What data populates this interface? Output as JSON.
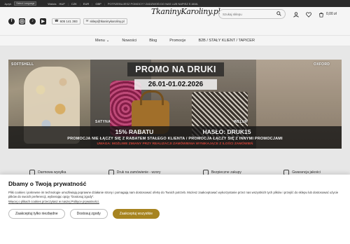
{
  "topbar": {
    "lang_label": "Język",
    "lang_value": "Select Language",
    "currency_label": "Waluta",
    "currencies": [
      "HUF",
      "CZK",
      "EUR",
      "GBP"
    ],
    "notice": "POTRZEBUJESZ POMOCY? ZADZWOŃ DO NAS LUB NAPISZ E-MAIL"
  },
  "header": {
    "phone": "605 141 393",
    "email": "sklep@tkaninykaroliny.pl",
    "logo_text": "TkaninyKaroliny.pl",
    "search_placeholder": "Szukaj sklepu",
    "cart_total": "0,00 zł",
    "icons": [
      "facebook-icon",
      "instagram-icon",
      "tiktok-icon",
      "youtube-icon",
      "phone-icon",
      "mail-icon",
      "search-icon",
      "user-icon",
      "heart-icon",
      "cart-icon"
    ]
  },
  "nav": {
    "items": [
      "Menu",
      "Nowości",
      "Blog",
      "Promocje",
      "B2B / STAŁY KLIENT / TAPICER"
    ]
  },
  "banner": {
    "tags": [
      "SOFTSHELL",
      "SATYNA",
      "WELUR",
      "OXFORD"
    ],
    "title": "PROMO NA DRUKI",
    "date": "26.01-01.02.2026",
    "discount": "15% RABATU",
    "code": "HASŁO: DRUK15",
    "line2": "PROMOCJA NIE ŁĄCZY SIĘ Z RABATEM STAŁEGO KLIENTA / PROMOCJA ŁĄCZY SIĘ Z INNYMI PROMOCJAMI",
    "line3": "UWAGA: MOŻLIWE ZMIANY PRZY REALIZACJI ZAMÓWIENIA WYNIKAJĄCE Z ILOŚCI ZAMÓWIEŃ"
  },
  "features": [
    "Darmowa wysyłka",
    "Druk na zamówienie - wzory",
    "Bezpieczne zakupy",
    "Gwarancja jakości"
  ],
  "cookie": {
    "title": "Dbamy o Twoją prywatność",
    "body": "Pliki cookies i pokrewne im technologie umożliwiają poprawne działanie strony i pomagają nam dostosować ofertę do Twoich potrzeb. Możesz zaakceptować wykorzystanie przez nas wszystkich tych plików i przejść do sklepu lub dostosować użycie plików do swoich preferencji, wybierając opcję \"Dostosuj zgody\".",
    "link": "Więcej o plikach cookies przeczytasz w naszej Polityce prywatności.",
    "btn_necessary": "Zaakceptuj tylko niezbędne",
    "btn_customize": "Dostosuj zgody",
    "btn_accept_all": "Zaakceptuj wszystkie"
  },
  "colors": {
    "accent": "#a78420",
    "topbar": "#2d2d2d",
    "promo_red": "#d9463a"
  }
}
